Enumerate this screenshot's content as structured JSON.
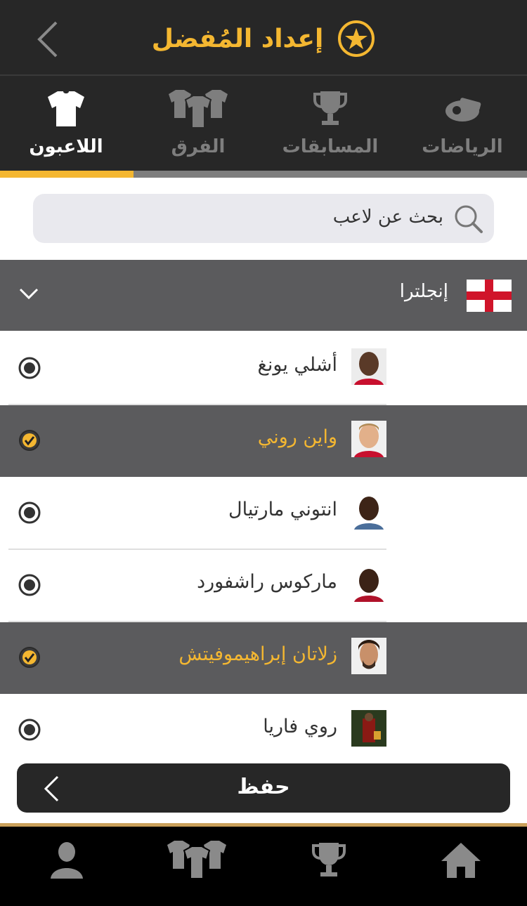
{
  "header": {
    "title": "إعداد المُفضل",
    "accent": "#f4b731"
  },
  "tabs": [
    {
      "label": "الرياضات",
      "icon": "whistle-icon"
    },
    {
      "label": "المسابقات",
      "icon": "trophy-icon"
    },
    {
      "label": "الفرق",
      "icon": "team-shirts-icon"
    },
    {
      "label": "اللاعبون",
      "icon": "shirt-icon",
      "active": true
    }
  ],
  "search": {
    "placeholder": "بحث عن لاعب"
  },
  "group": {
    "label": "إنجلترا",
    "flag": "england-flag-icon"
  },
  "players": [
    {
      "name": "أشلي يونغ",
      "selected": false
    },
    {
      "name": "واين روني",
      "selected": true
    },
    {
      "name": "انتوني مارتيال",
      "selected": false
    },
    {
      "name": "ماركوس راشفورد",
      "selected": false
    },
    {
      "name": "زلاتان إبراهيموفيتش",
      "selected": true
    },
    {
      "name": "روي فاريا",
      "selected": false
    }
  ],
  "save": {
    "label": "حفظ"
  },
  "bottom_nav": [
    "profile-icon",
    "teams-icon",
    "trophy-icon",
    "home-icon"
  ]
}
